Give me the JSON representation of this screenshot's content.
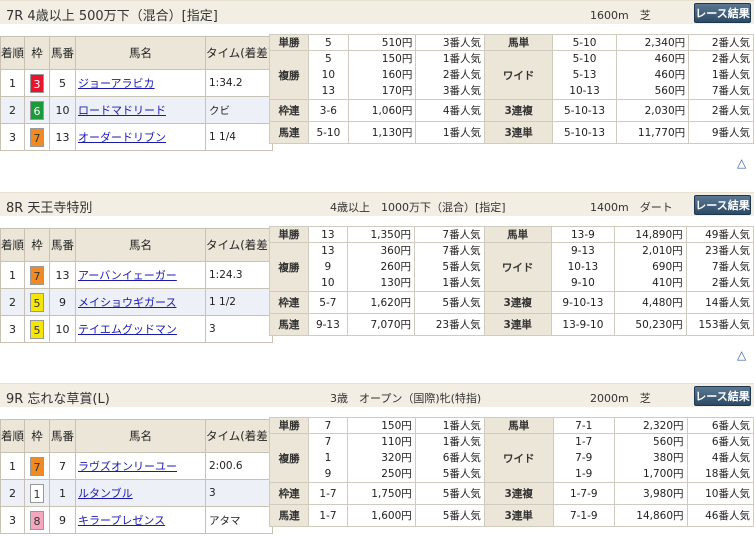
{
  "headers": {
    "finish": "着順",
    "bracket": "枠",
    "number": "馬番",
    "horse": "馬名",
    "time": "タイム(着差)"
  },
  "payout_labels": {
    "win": "単勝",
    "place": "複勝",
    "bracket_quinella": "枠連",
    "quinella": "馬連",
    "exacta": "馬単",
    "wide": "ワイド",
    "trio": "3連複",
    "trifecta": "3連単"
  },
  "results_button": "レース結果",
  "colors": {
    "w1": "#ffffff",
    "w3": "#e8142e",
    "w5": "#f5e60a",
    "w6": "#1a9a3a",
    "w7": "#f08a24",
    "w8": "#f4a8c0",
    "button": "#2c4a66",
    "link": "#1a1ab0"
  },
  "races": [
    {
      "name": "7R 4歳以上 500万下（混合）[指定]",
      "conditions": "",
      "distance": "1600m　芝",
      "finishers": [
        {
          "pos": "1",
          "waku": "3",
          "waku_color": "red",
          "num": "5",
          "horse": "ジョーアラビカ",
          "time": "1:34.2"
        },
        {
          "pos": "2",
          "waku": "6",
          "waku_color": "green",
          "num": "10",
          "horse": "ロードマドリード",
          "time": "クビ"
        },
        {
          "pos": "3",
          "waku": "7",
          "waku_color": "orange",
          "num": "13",
          "horse": "オーダードリブン",
          "time": "1 1/4"
        }
      ],
      "payouts": {
        "win": {
          "num": "5",
          "amt": "510円",
          "pop": "3番人気"
        },
        "place": {
          "nums": [
            "5",
            "10",
            "13"
          ],
          "amts": [
            "150円",
            "160円",
            "170円"
          ],
          "pops": [
            "1番人気",
            "2番人気",
            "3番人気"
          ]
        },
        "bracket_quinella": {
          "num": "3-6",
          "amt": "1,060円",
          "pop": "4番人気"
        },
        "quinella": {
          "num": "5-10",
          "amt": "1,130円",
          "pop": "1番人気"
        },
        "exacta": {
          "num": "5-10",
          "amt": "2,340円",
          "pop": "2番人気"
        },
        "wide": {
          "nums": [
            "5-10",
            "5-13",
            "10-13"
          ],
          "amts": [
            "460円",
            "460円",
            "560円"
          ],
          "pops": [
            "2番人気",
            "1番人気",
            "7番人気"
          ]
        },
        "trio": {
          "num": "5-10-13",
          "amt": "2,030円",
          "pop": "2番人気"
        },
        "trifecta": {
          "num": "5-10-13",
          "amt": "11,770円",
          "pop": "9番人気"
        }
      }
    },
    {
      "name": "8R 天王寺特別",
      "conditions": "4歳以上　1000万下（混合）[指定]",
      "distance": "1400m　ダート",
      "finishers": [
        {
          "pos": "1",
          "waku": "7",
          "waku_color": "orange",
          "num": "13",
          "horse": "アーバンイェーガー",
          "time": "1:24.3"
        },
        {
          "pos": "2",
          "waku": "5",
          "waku_color": "yellow",
          "num": "9",
          "horse": "メイショウギガース",
          "time": "1 1/2"
        },
        {
          "pos": "3",
          "waku": "5",
          "waku_color": "yellow",
          "num": "10",
          "horse": "テイエムグッドマン",
          "time": "3"
        }
      ],
      "payouts": {
        "win": {
          "num": "13",
          "amt": "1,350円",
          "pop": "7番人気"
        },
        "place": {
          "nums": [
            "13",
            "9",
            "10"
          ],
          "amts": [
            "360円",
            "260円",
            "130円"
          ],
          "pops": [
            "7番人気",
            "5番人気",
            "1番人気"
          ]
        },
        "bracket_quinella": {
          "num": "5-7",
          "amt": "1,620円",
          "pop": "5番人気"
        },
        "quinella": {
          "num": "9-13",
          "amt": "7,070円",
          "pop": "23番人気"
        },
        "exacta": {
          "num": "13-9",
          "amt": "14,890円",
          "pop": "49番人気"
        },
        "wide": {
          "nums": [
            "9-13",
            "10-13",
            "9-10"
          ],
          "amts": [
            "2,010円",
            "690円",
            "410円"
          ],
          "pops": [
            "23番人気",
            "7番人気",
            "2番人気"
          ]
        },
        "trio": {
          "num": "9-10-13",
          "amt": "4,480円",
          "pop": "14番人気"
        },
        "trifecta": {
          "num": "13-9-10",
          "amt": "50,230円",
          "pop": "153番人気"
        }
      }
    },
    {
      "name": "9R 忘れな草賞(L)",
      "conditions": "3歳　オープン（国際)牝(特指)",
      "distance": "2000m　芝",
      "finishers": [
        {
          "pos": "1",
          "waku": "7",
          "waku_color": "orange",
          "num": "7",
          "horse": "ラヴズオンリーユー",
          "time": "2:00.6"
        },
        {
          "pos": "2",
          "waku": "1",
          "waku_color": "white",
          "num": "1",
          "horse": "ルタンブル",
          "time": "3"
        },
        {
          "pos": "3",
          "waku": "8",
          "waku_color": "pink",
          "num": "9",
          "horse": "キラープレゼンス",
          "time": "アタマ"
        }
      ],
      "payouts": {
        "win": {
          "num": "7",
          "amt": "150円",
          "pop": "1番人気"
        },
        "place": {
          "nums": [
            "7",
            "1",
            "9"
          ],
          "amts": [
            "110円",
            "320円",
            "250円"
          ],
          "pops": [
            "1番人気",
            "6番人気",
            "5番人気"
          ]
        },
        "bracket_quinella": {
          "num": "1-7",
          "amt": "1,750円",
          "pop": "5番人気"
        },
        "quinella": {
          "num": "1-7",
          "amt": "1,600円",
          "pop": "5番人気"
        },
        "exacta": {
          "num": "7-1",
          "amt": "2,320円",
          "pop": "6番人気"
        },
        "wide": {
          "nums": [
            "1-7",
            "7-9",
            "1-9"
          ],
          "amts": [
            "560円",
            "380円",
            "1,700円"
          ],
          "pops": [
            "6番人気",
            "4番人気",
            "18番人気"
          ]
        },
        "trio": {
          "num": "1-7-9",
          "amt": "3,980円",
          "pop": "10番人気"
        },
        "trifecta": {
          "num": "7-1-9",
          "amt": "14,860円",
          "pop": "46番人気"
        }
      }
    }
  ]
}
